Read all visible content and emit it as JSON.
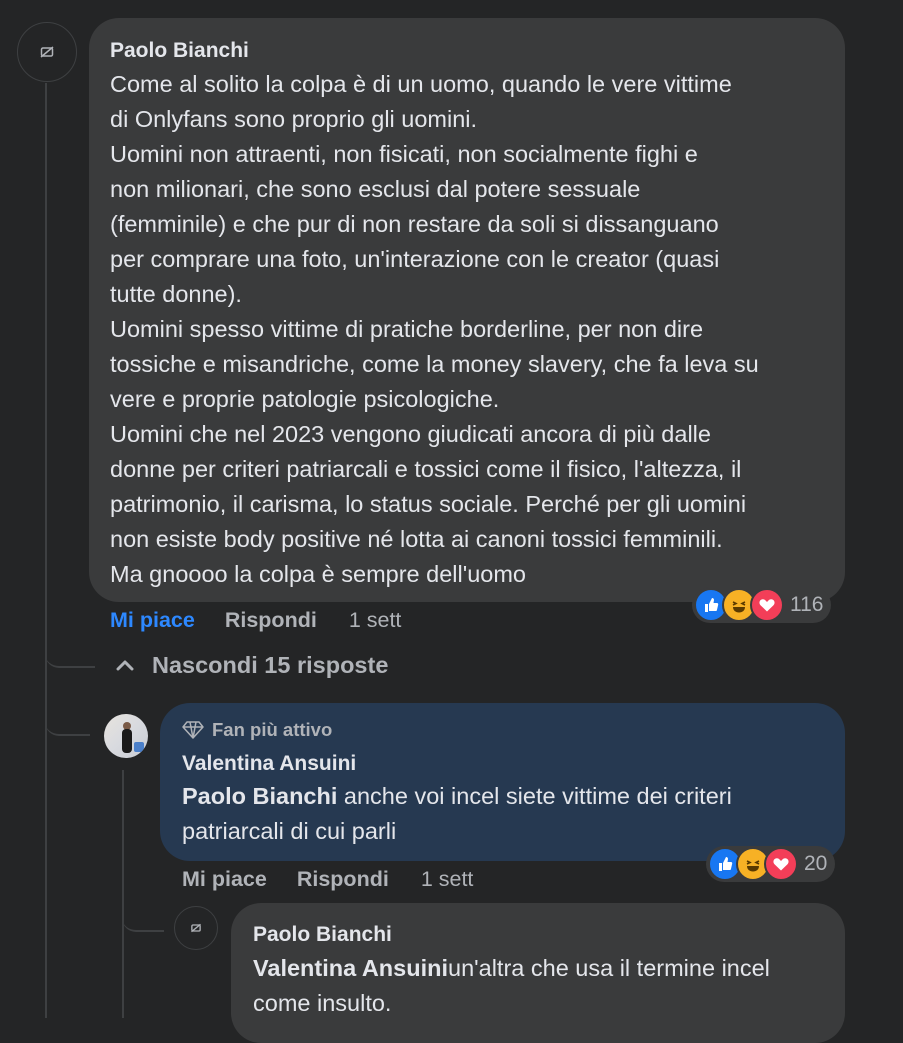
{
  "comment_main": {
    "author": "Paolo Bianchi",
    "text": "Come al solito la colpa è di un uomo, quando le vere vittime\ndi Onlyfans sono proprio gli uomini.\nUomini non attraenti, non fisicati, non socialmente fighi e\nnon milionari, che sono esclusi dal potere sessuale\n(femminile) e che pur di non restare da soli si dissanguano\nper comprare una foto, un'interazione con le creator (quasi\ntutte donne).\nUomini spesso vittime di pratiche borderline, per non dire\ntossiche e misandriche, come la money slavery, che fa leva su\nvere e proprie patologie psicologiche.\nUomini che nel 2023 vengono giudicati ancora di più dalle\ndonne per criteri patriarcali e tossici come il fisico, l'altezza, il\npatrimonio, il carisma, lo status sociale. Perché per gli uomini\nnon esiste body positive né lotta ai canoni tossici femminili.\nMa gnoooo la colpa è sempre dell'uomo",
    "like_label": "Mi piace",
    "reply_label": "Rispondi",
    "time": "1 sett",
    "reaction_count": "116"
  },
  "hide_replies_label": "Nascondi 15 risposte",
  "reply_1": {
    "badge": "Fan più attivo",
    "author": "Valentina Ansuini",
    "mention": "Paolo Bianchi",
    "text": " anche voi incel siete vittime dei criteri\npatriarcali di cui parli",
    "like_label": "Mi piace",
    "reply_label": "Rispondi",
    "time": "1 sett",
    "reaction_count": "20"
  },
  "reply_2": {
    "author": "Paolo Bianchi",
    "mention": "Valentina Ansuini",
    "text": "un'altra che usa il termine incel\ncome insulto."
  },
  "colors": {
    "background": "#242526",
    "bubble": "#3a3b3c",
    "bubble_highlight": "#263951",
    "like_active": "#2d88ff",
    "muted_text": "#b0b3b8"
  }
}
